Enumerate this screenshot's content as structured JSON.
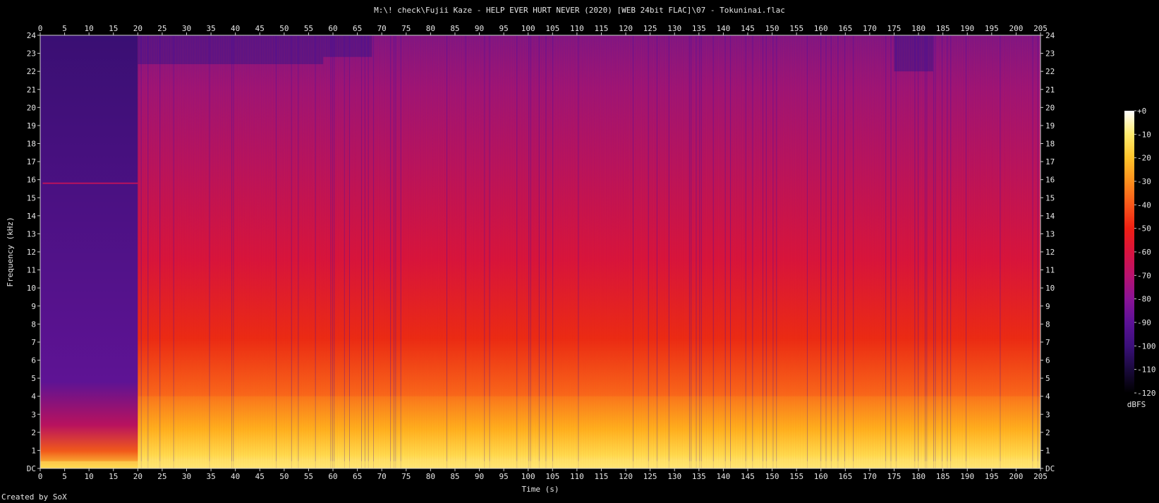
{
  "window": {
    "title": "M:\\! check\\Fujii Kaze - HELP EVER HURT NEVER (2020) [WEB 24bit FLAC]\\07 - Tokuninai.flac",
    "footer": "Created by SoX"
  },
  "colors": {
    "background": "#000000",
    "text": "#e6e6e6",
    "axis": "#cfcfcf",
    "colormap": [
      "#000000",
      "#1a0a3c",
      "#3a0f7a",
      "#5c1196",
      "#8a1396",
      "#b8126e",
      "#d8133e",
      "#ee1f13",
      "#f9571a",
      "#fd8f1d",
      "#ffc32a",
      "#ffeb6e",
      "#ffffff"
    ]
  },
  "chart_data": {
    "type": "heatmap",
    "title": "M:\\! check\\Fujii Kaze - HELP EVER HURT NEVER (2020) [WEB 24bit FLAC]\\07 - Tokuninai.flac",
    "xlabel": "Time (s)",
    "ylabel": "Frequency (kHz)",
    "x_ticks": [
      "0",
      "5",
      "10",
      "15",
      "20",
      "25",
      "30",
      "35",
      "40",
      "45",
      "50",
      "55",
      "60",
      "65",
      "70",
      "75",
      "80",
      "85",
      "90",
      "95",
      "100",
      "105",
      "110",
      "115",
      "120",
      "125",
      "130",
      "135",
      "140",
      "145",
      "150",
      "155",
      "160",
      "165",
      "170",
      "175",
      "180",
      "185",
      "190",
      "195",
      "200",
      "205"
    ],
    "y_ticks": [
      "DC",
      "1",
      "2",
      "3",
      "4",
      "5",
      "6",
      "7",
      "8",
      "9",
      "10",
      "11",
      "12",
      "13",
      "14",
      "15",
      "16",
      "17",
      "18",
      "19",
      "20",
      "21",
      "22",
      "23",
      "24"
    ],
    "xlim": [
      0,
      205
    ],
    "ylim": [
      0,
      24
    ],
    "colorbar": {
      "label": "dBFS",
      "ticks": [
        "+0",
        "-10",
        "-20",
        "-30",
        "-40",
        "-50",
        "-60",
        "-70",
        "-80",
        "-90",
        "-100",
        "-110",
        "-120"
      ],
      "range": [
        -120,
        0
      ]
    },
    "segments": [
      {
        "start": 0,
        "end": 20,
        "character": "quiet intro, energy mostly below 4 kHz, upper band near -100 dBFS"
      },
      {
        "start": 20,
        "end": 58,
        "character": "full band, loud lows, reds up to 13 kHz"
      },
      {
        "start": 58,
        "end": 68,
        "character": "slightly quieter upper band"
      },
      {
        "start": 68,
        "end": 175,
        "character": "dense full-band energy, strong lows up to 4 kHz"
      },
      {
        "start": 175,
        "end": 183,
        "character": "quieter top band"
      },
      {
        "start": 183,
        "end": 205,
        "character": "dense full-band energy"
      }
    ]
  }
}
